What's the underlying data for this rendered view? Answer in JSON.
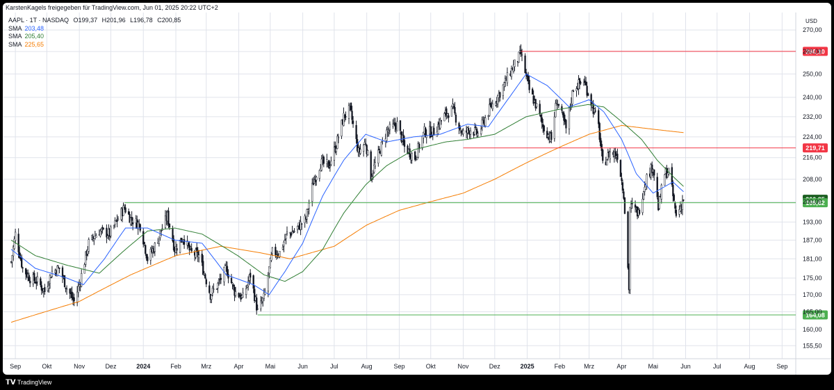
{
  "header": {
    "shared_by": "KarstenKagels freigegeben für TradingView.com, Jun 01, 2025 20:22 UTC+2"
  },
  "legend": {
    "symbol": "AAPL · 1T · NASDAQ",
    "ohlc": {
      "o": "O199,37",
      "h": "H201,96",
      "l": "L196,78",
      "c": "C200,85"
    },
    "sma": [
      {
        "label": "SMA",
        "value": "203,48",
        "color": "#2962ff"
      },
      {
        "label": "SMA",
        "value": "205,40",
        "color": "#2e7d32"
      },
      {
        "label": "SMA",
        "value": "225,65",
        "color": "#f57c00"
      }
    ]
  },
  "footer": {
    "brand": "TradingView"
  },
  "chart_data": {
    "type": "candlestick",
    "currency_label": "USD",
    "y_scale": "log",
    "ylim": [
      152,
      277
    ],
    "y_ticks": [
      "270,00",
      "260,00",
      "250,00",
      "240,00",
      "232,00",
      "224,00",
      "216,00",
      "208,00",
      "200,00",
      "193,00",
      "187,00",
      "181,00",
      "175,00",
      "170,00",
      "165,00",
      "160,00",
      "155,50"
    ],
    "x_ticks": [
      "Sep",
      "Okt",
      "Nov",
      "Dez",
      "2024",
      "Feb",
      "Mrz",
      "Apr",
      "Mai",
      "Jun",
      "Jul",
      "Aug",
      "Sep",
      "Okt",
      "Nov",
      "Dez",
      "2025",
      "Feb",
      "Mrz",
      "Apr",
      "Mai",
      "Jun",
      "Jul",
      "Aug",
      "Sep"
    ],
    "price_anchors": [
      [
        "2023-08-28",
        180
      ],
      [
        "2023-09-01",
        189
      ],
      [
        "2023-09-08",
        178
      ],
      [
        "2023-09-15",
        175
      ],
      [
        "2023-09-22",
        174
      ],
      [
        "2023-09-29",
        171
      ],
      [
        "2023-10-06",
        177
      ],
      [
        "2023-10-13",
        178
      ],
      [
        "2023-10-20",
        172
      ],
      [
        "2023-10-27",
        168
      ],
      [
        "2023-11-01",
        173
      ],
      [
        "2023-11-10",
        186
      ],
      [
        "2023-11-20",
        190
      ],
      [
        "2023-11-30",
        189
      ],
      [
        "2023-12-06",
        193
      ],
      [
        "2023-12-14",
        198
      ],
      [
        "2023-12-20",
        194
      ],
      [
        "2023-12-29",
        192
      ],
      [
        "2024-01-05",
        181
      ],
      [
        "2024-01-12",
        185
      ],
      [
        "2024-01-19",
        191
      ],
      [
        "2024-01-24",
        195
      ],
      [
        "2024-01-31",
        184
      ],
      [
        "2024-02-08",
        188
      ],
      [
        "2024-02-15",
        183
      ],
      [
        "2024-02-23",
        182
      ],
      [
        "2024-03-05",
        170
      ],
      [
        "2024-03-12",
        173
      ],
      [
        "2024-03-20",
        178
      ],
      [
        "2024-03-28",
        171
      ],
      [
        "2024-04-05",
        169
      ],
      [
        "2024-04-12",
        176
      ],
      [
        "2024-04-19",
        165
      ],
      [
        "2024-04-25",
        169
      ],
      [
        "2024-05-03",
        183
      ],
      [
        "2024-05-10",
        183
      ],
      [
        "2024-05-17",
        189
      ],
      [
        "2024-05-24",
        190
      ],
      [
        "2024-06-04",
        194
      ],
      [
        "2024-06-11",
        207
      ],
      [
        "2024-06-18",
        214
      ],
      [
        "2024-06-26",
        213
      ],
      [
        "2024-07-03",
        221
      ],
      [
        "2024-07-10",
        232
      ],
      [
        "2024-07-16",
        235
      ],
      [
        "2024-07-24",
        218
      ],
      [
        "2024-07-31",
        222
      ],
      [
        "2024-08-05",
        209
      ],
      [
        "2024-08-12",
        217
      ],
      [
        "2024-08-20",
        226
      ],
      [
        "2024-08-30",
        229
      ],
      [
        "2024-09-06",
        220
      ],
      [
        "2024-09-16",
        216
      ],
      [
        "2024-09-25",
        226
      ],
      [
        "2024-10-04",
        226
      ],
      [
        "2024-10-15",
        233
      ],
      [
        "2024-10-22",
        235
      ],
      [
        "2024-10-31",
        225
      ],
      [
        "2024-11-08",
        227
      ],
      [
        "2024-11-15",
        225
      ],
      [
        "2024-11-26",
        235
      ],
      [
        "2024-12-06",
        242
      ],
      [
        "2024-12-16",
        251
      ],
      [
        "2024-12-26",
        259
      ],
      [
        "2025-01-03",
        243
      ],
      [
        "2025-01-10",
        236
      ],
      [
        "2025-01-16",
        228
      ],
      [
        "2025-01-24",
        223
      ],
      [
        "2025-01-29",
        239
      ],
      [
        "2025-02-07",
        227
      ],
      [
        "2025-02-14",
        244
      ],
      [
        "2025-02-24",
        247
      ],
      [
        "2025-03-03",
        238
      ],
      [
        "2025-03-10",
        228
      ],
      [
        "2025-03-14",
        213
      ],
      [
        "2025-03-21",
        218
      ],
      [
        "2025-03-28",
        217
      ],
      [
        "2025-04-03",
        203
      ],
      [
        "2025-04-08",
        172
      ],
      [
        "2025-04-09",
        198
      ],
      [
        "2025-04-11",
        198
      ],
      [
        "2025-04-17",
        196
      ],
      [
        "2025-04-24",
        208
      ],
      [
        "2025-05-01",
        213
      ],
      [
        "2025-05-06",
        198
      ],
      [
        "2025-05-12",
        210
      ],
      [
        "2025-05-16",
        211
      ],
      [
        "2025-05-23",
        195
      ],
      [
        "2025-05-30",
        201
      ]
    ],
    "sma_blue_anchors": [
      [
        "2023-08-28",
        184
      ],
      [
        "2023-09-20",
        178
      ],
      [
        "2023-10-20",
        175
      ],
      [
        "2023-11-05",
        173
      ],
      [
        "2023-11-25",
        181
      ],
      [
        "2023-12-15",
        191
      ],
      [
        "2024-01-05",
        191
      ],
      [
        "2024-01-31",
        187
      ],
      [
        "2024-02-26",
        186
      ],
      [
        "2024-03-20",
        176
      ],
      [
        "2024-04-15",
        173
      ],
      [
        "2024-04-30",
        170
      ],
      [
        "2024-05-15",
        177
      ],
      [
        "2024-06-01",
        186
      ],
      [
        "2024-06-20",
        202
      ],
      [
        "2024-07-10",
        215
      ],
      [
        "2024-07-31",
        225
      ],
      [
        "2024-08-20",
        222
      ],
      [
        "2024-09-15",
        224
      ],
      [
        "2024-10-10",
        225
      ],
      [
        "2024-11-05",
        229
      ],
      [
        "2024-11-25",
        228
      ],
      [
        "2024-12-15",
        240
      ],
      [
        "2024-12-31",
        250
      ],
      [
        "2025-01-20",
        245
      ],
      [
        "2025-02-10",
        236
      ],
      [
        "2025-03-01",
        239
      ],
      [
        "2025-03-15",
        234
      ],
      [
        "2025-04-01",
        223
      ],
      [
        "2025-04-15",
        210
      ],
      [
        "2025-05-01",
        203
      ],
      [
        "2025-05-20",
        207
      ],
      [
        "2025-05-30",
        203.5
      ]
    ],
    "sma_green_anchors": [
      [
        "2023-08-28",
        187
      ],
      [
        "2023-09-20",
        182
      ],
      [
        "2023-10-20",
        179
      ],
      [
        "2023-11-20",
        176.5
      ],
      [
        "2023-12-15",
        184
      ],
      [
        "2024-01-05",
        190
      ],
      [
        "2024-01-31",
        191
      ],
      [
        "2024-02-26",
        189
      ],
      [
        "2024-03-31",
        182
      ],
      [
        "2024-04-25",
        176
      ],
      [
        "2024-05-15",
        174
      ],
      [
        "2024-06-01",
        177
      ],
      [
        "2024-06-20",
        184
      ],
      [
        "2024-07-10",
        196
      ],
      [
        "2024-07-31",
        206
      ],
      [
        "2024-08-20",
        213
      ],
      [
        "2024-09-15",
        219
      ],
      [
        "2024-10-15",
        222
      ],
      [
        "2024-11-05",
        223
      ],
      [
        "2024-12-01",
        225
      ],
      [
        "2024-12-31",
        232
      ],
      [
        "2025-01-31",
        235
      ],
      [
        "2025-02-28",
        237
      ],
      [
        "2025-03-15",
        236
      ],
      [
        "2025-04-01",
        230
      ],
      [
        "2025-04-20",
        223
      ],
      [
        "2025-05-05",
        215
      ],
      [
        "2025-05-20",
        209
      ],
      [
        "2025-05-30",
        205.4
      ]
    ],
    "sma_orange_anchors": [
      [
        "2023-08-28",
        162
      ],
      [
        "2023-11-01",
        168
      ],
      [
        "2023-12-20",
        176
      ],
      [
        "2024-02-01",
        182
      ],
      [
        "2024-03-15",
        185
      ],
      [
        "2024-04-20",
        183
      ],
      [
        "2024-05-20",
        181
      ],
      [
        "2024-07-01",
        185
      ],
      [
        "2024-08-01",
        192
      ],
      [
        "2024-09-01",
        197
      ],
      [
        "2024-10-01",
        200
      ],
      [
        "2024-11-01",
        203
      ],
      [
        "2024-12-01",
        208
      ],
      [
        "2024-12-31",
        214
      ],
      [
        "2025-02-01",
        220
      ],
      [
        "2025-03-01",
        225
      ],
      [
        "2025-04-01",
        228.5
      ],
      [
        "2025-05-01",
        227
      ],
      [
        "2025-05-30",
        225.65
      ]
    ],
    "horizontal_levels": [
      {
        "price": 260.1,
        "label": "260,10",
        "color": "#f23645",
        "start": "2024-12-26"
      },
      {
        "price": 219.71,
        "label": "219,71",
        "color": "#f23645",
        "start": "2024-11-01"
      },
      {
        "price": 200.85,
        "label": "200,85",
        "color": "#1b5e20",
        "start": null
      },
      {
        "price": 199.62,
        "label": "199,62",
        "color": "#4caf50",
        "start": "2023-12-14"
      },
      {
        "price": 164.08,
        "label": "164,08",
        "color": "#4caf50",
        "start": "2024-04-19"
      }
    ],
    "colors": {
      "up": "#089981",
      "down": "#f23645",
      "bar": "#131722",
      "grid": "#e0e3eb"
    }
  }
}
